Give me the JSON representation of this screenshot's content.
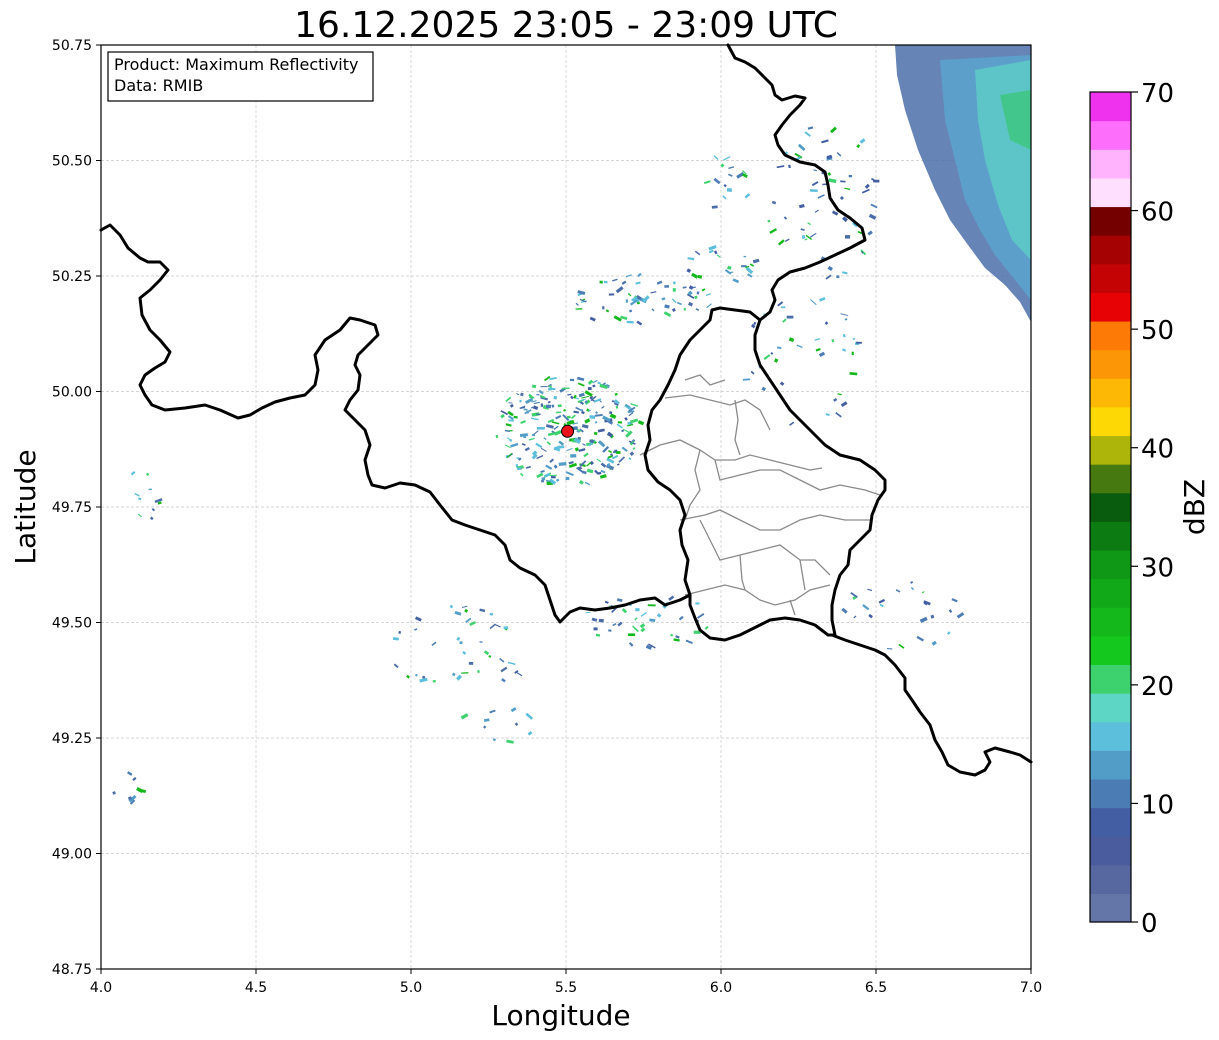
{
  "title": "16.12.2025 23:05 - 23:09 UTC",
  "xlabel": "Longitude",
  "ylabel": "Latitude",
  "info_box": {
    "product": "Product: Maximum Reflectivity",
    "data": "Data: RMIB"
  },
  "axes": {
    "lon_range": [
      4.0,
      7.0
    ],
    "lat_range": [
      48.75,
      50.75
    ],
    "lon_ticks": [
      "4.0",
      "4.5",
      "5.0",
      "5.5",
      "6.0",
      "6.5",
      "7.0"
    ],
    "lat_ticks": [
      "48.75",
      "49.00",
      "49.25",
      "49.50",
      "49.75",
      "50.00",
      "50.25",
      "50.50",
      "50.75"
    ],
    "grid": true
  },
  "radar_site": {
    "lon": 5.505,
    "lat": 49.914,
    "color": "#e8131b"
  },
  "colorbar": {
    "label": "dBZ",
    "min": 0,
    "max": 70,
    "ticks": [
      "0",
      "10",
      "20",
      "30",
      "40",
      "50",
      "60",
      "70"
    ],
    "colors": [
      "#6475a8",
      "#56689f",
      "#4a5c9d",
      "#435ea3",
      "#4b7db4",
      "#529dc7",
      "#5cbfdb",
      "#5ed6c6",
      "#3ed26f",
      "#14c81d",
      "#14b81a",
      "#11a918",
      "#0f9716",
      "#0c7c12",
      "#095c0d",
      "#477911",
      "#adb50a",
      "#fdd805",
      "#fdb805",
      "#fc9606",
      "#fc7a05",
      "#e60205",
      "#c40305",
      "#a40203",
      "#740000",
      "#ffdefe",
      "#ffb3fd",
      "#fd6ffb",
      "#ef32ed"
    ]
  },
  "map_colors": {
    "border": "#000000",
    "district": "#8a8a8a",
    "grid": "#c8c8c8"
  }
}
